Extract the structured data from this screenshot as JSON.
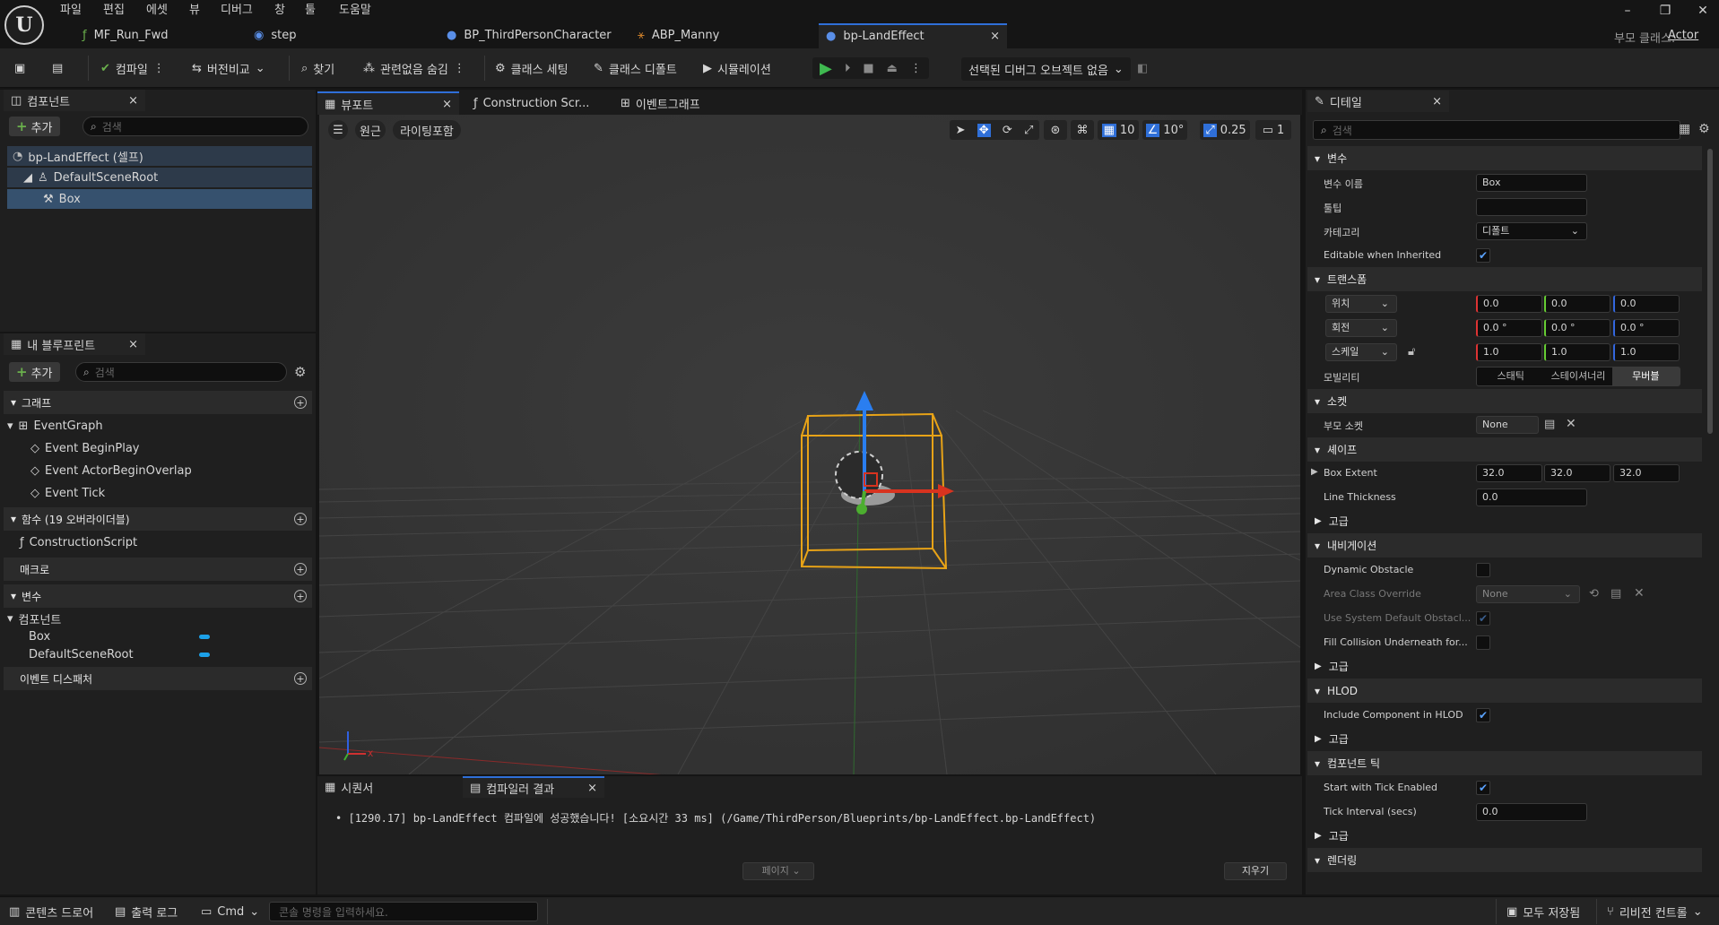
{
  "menu": [
    "파일",
    "편집",
    "에셋",
    "뷰",
    "디버그",
    "창",
    "툴",
    "도움말"
  ],
  "doc_tabs": [
    "MF_Run_Fwd",
    "step",
    "BP_ThirdPersonCharacter",
    "ABP_Manny",
    "bp-LandEffect"
  ],
  "parent_class": {
    "label": "부모 클래스:",
    "value": "Actor"
  },
  "toolbar": {
    "compile": "컴파일",
    "diff": "버전비교",
    "find": "찾기",
    "hide_unrelated": "관련없음 숨김",
    "class_settings": "클래스 세팅",
    "class_defaults": "클래스 디폴트",
    "simulation": "시뮬레이션",
    "debug_object": "선택된 디버그 오브젝트 없음"
  },
  "components_panel": {
    "tab": "컴포넌트",
    "add": "추가",
    "search_placeholder": "검색",
    "items": [
      "bp-LandEffect (셀프)",
      "DefaultSceneRoot",
      "Box"
    ]
  },
  "my_blueprint": {
    "tab": "내 블루프린트",
    "add": "추가",
    "search_placeholder": "검색",
    "graphs_header": "그래프",
    "event_graph": "EventGraph",
    "events": [
      "Event BeginPlay",
      "Event ActorBeginOverlap",
      "Event Tick"
    ],
    "functions_header": "함수 (19 오버라이더블)",
    "construction_script": "ConstructionScript",
    "macros_header": "매크로",
    "variables_header": "변수",
    "components_group": "컴포넌트",
    "variables": [
      "Box",
      "DefaultSceneRoot"
    ],
    "dispatchers_header": "이벤트 디스패처"
  },
  "center_tabs": [
    "뷰포트",
    "Construction Scr...",
    "이벤트그래프"
  ],
  "viewport": {
    "perspective": "원근",
    "lit": "라이팅포함",
    "grid_snap": "10",
    "rot_snap": "10°",
    "scale_snap": "0.25",
    "camera_speed": "1"
  },
  "bottom_tabs": [
    "시퀀서",
    "컴파일러 결과"
  ],
  "compiler_log": "[1290.17] bp-LandEffect 컴파일에 성공했습니다! [소요시간 33 ms] (/Game/ThirdPerson/Blueprints/bp-LandEffect.bp-LandEffect)",
  "pagination": "페이지",
  "clear": "지우기",
  "details": {
    "tab": "디테일",
    "search_placeholder": "검색",
    "variable_header": "변수",
    "var_name_label": "변수 이름",
    "var_name": "Box",
    "tooltip_label": "툴팁",
    "category_label": "카테고리",
    "category": "디폴트",
    "editable_inherited": "Editable when Inherited",
    "transform_header": "트랜스폼",
    "location": "위치",
    "rotation": "회전",
    "scale": "스케일",
    "location_values": [
      "0.0",
      "0.0",
      "0.0"
    ],
    "rotation_values": [
      "0.0 °",
      "0.0 °",
      "0.0 °"
    ],
    "scale_values": [
      "1.0",
      "1.0",
      "1.0"
    ],
    "mobility_label": "모빌리티",
    "mobility_options": [
      "스태틱",
      "스테이셔너리",
      "무버블"
    ],
    "socket_header": "소켓",
    "parent_socket_label": "부모 소켓",
    "parent_socket": "None",
    "shape_header": "셰이프",
    "box_extent_label": "Box Extent",
    "box_extent": [
      "32.0",
      "32.0",
      "32.0"
    ],
    "line_thickness_label": "Line Thickness",
    "line_thickness": "0.0",
    "advanced": "고급",
    "navigation_header": "내비게이션",
    "dynamic_obstacle": "Dynamic Obstacle",
    "area_class_override": "Area Class Override",
    "area_class_value": "None",
    "use_system_default": "Use System Default Obstacl...",
    "fill_collision": "Fill Collision Underneath for...",
    "hlod_header": "HLOD",
    "include_hlod": "Include Component in HLOD",
    "tick_header": "컴포넌트 틱",
    "start_tick": "Start with Tick Enabled",
    "tick_interval_label": "Tick Interval (secs)",
    "tick_interval": "0.0",
    "rendering_header": "렌더링"
  },
  "statusbar": {
    "content_drawer": "콘텐츠 드로어",
    "output_log": "출력 로그",
    "cmd": "Cmd",
    "console_placeholder": "콘솔 명령을 입력하세요.",
    "save_all": "모두 저장됨",
    "revision_control": "리비전 컨트롤"
  },
  "colors": {
    "accent": "#2f6fd8",
    "play": "#3fb950",
    "selection": "#36516e",
    "pill": "#1ca0e8"
  }
}
